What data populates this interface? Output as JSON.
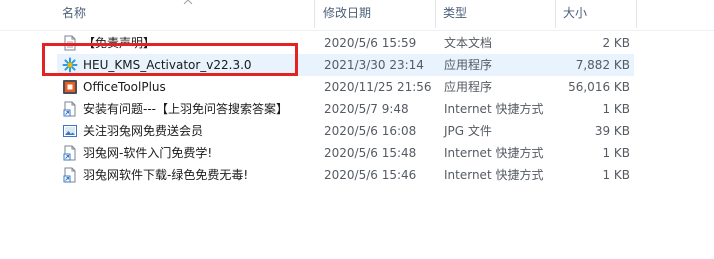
{
  "columns": {
    "name": "名称",
    "date": "修改日期",
    "type": "类型",
    "size": "大小"
  },
  "files": [
    {
      "name": "【免责声明】",
      "date": "2020/5/6 15:59",
      "type": "文本文档",
      "size": "2 KB",
      "icon": "text-file-icon"
    },
    {
      "name": "HEU_KMS_Activator_v22.3.0",
      "date": "2021/3/30 23:14",
      "type": "应用程序",
      "size": "7,882 KB",
      "icon": "activator-app-icon"
    },
    {
      "name": "OfficeToolPlus",
      "date": "2020/11/25 21:56",
      "type": "应用程序",
      "size": "56,016 KB",
      "icon": "office-tool-app-icon"
    },
    {
      "name": "安装有问题---【上羽免问答搜索答案】",
      "date": "2020/5/7 9:48",
      "type": "Internet 快捷方式",
      "size": "1 KB",
      "icon": "internet-shortcut-icon"
    },
    {
      "name": "关注羽兔网免费送会员",
      "date": "2020/5/6 16:08",
      "type": "JPG 文件",
      "size": "39 KB",
      "icon": "jpg-image-icon"
    },
    {
      "name": "羽兔网-软件入门免费学!",
      "date": "2020/5/6 15:48",
      "type": "Internet 快捷方式",
      "size": "1 KB",
      "icon": "internet-shortcut-icon"
    },
    {
      "name": "羽兔网软件下载-绿色免费无毒!",
      "date": "2020/5/6 15:46",
      "type": "Internet 快捷方式",
      "size": "1 KB",
      "icon": "internet-shortcut-icon"
    }
  ],
  "colors": {
    "highlight_border": "#e32224",
    "selection_bg": "#e8f3fd",
    "header_text": "#4c607a"
  }
}
